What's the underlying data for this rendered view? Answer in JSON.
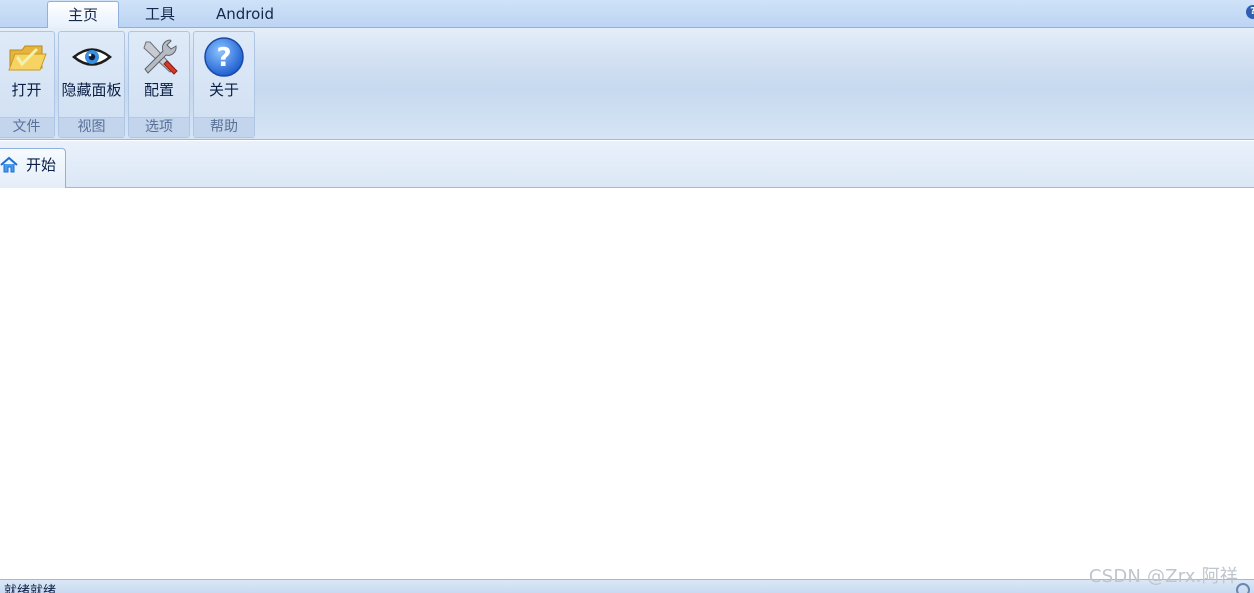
{
  "ribbon_tabs": [
    {
      "label": "主页",
      "active": true
    },
    {
      "label": "工具",
      "active": false
    },
    {
      "label": "Android",
      "active": false
    }
  ],
  "ribbon_groups": [
    {
      "button_label": "打开",
      "group_title": "文件",
      "icon": "folder-open-icon"
    },
    {
      "button_label": "隐藏面板",
      "group_title": "视图",
      "icon": "eye-icon"
    },
    {
      "button_label": "配置",
      "group_title": "选项",
      "icon": "tools-icon"
    },
    {
      "button_label": "关于",
      "group_title": "帮助",
      "icon": "help-icon"
    }
  ],
  "document_tabs": [
    {
      "label": "开始",
      "icon": "home-icon"
    }
  ],
  "status": {
    "text": "就绪就绪"
  },
  "watermark": "CSDN @Zrx.阿祥",
  "colors": {
    "ribbon_bg": "#c7d9ef",
    "tab_border": "#8fb1dc",
    "accent": "#2f5fb3"
  }
}
